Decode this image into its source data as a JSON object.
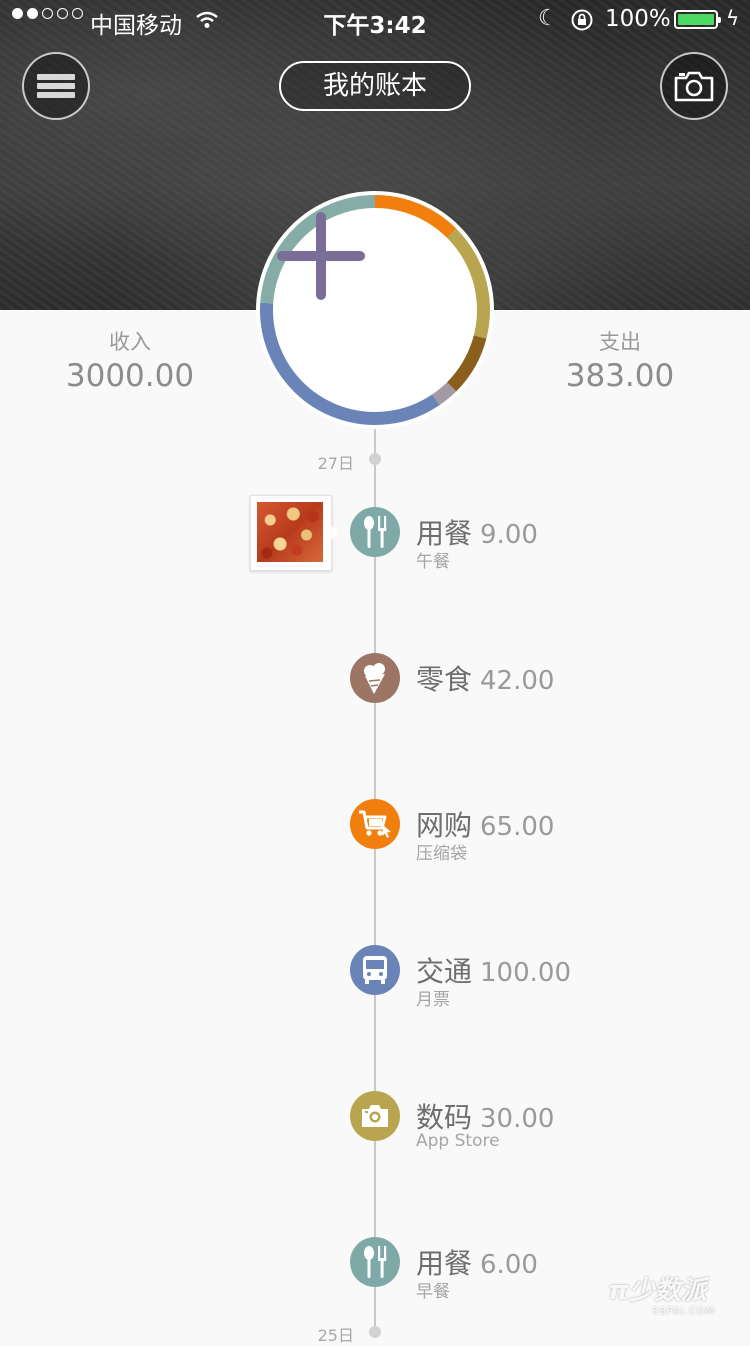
{
  "status_bar": {
    "carrier": "中国移动",
    "time": "下午3:42",
    "battery_percent": "100%",
    "signal_bars_filled": 2,
    "signal_bars_total": 5
  },
  "header": {
    "title": "我的账本",
    "menu_icon": "hamburger-menu-icon",
    "camera_icon": "camera-icon"
  },
  "summary": {
    "income_label": "收入",
    "income_value": "3000.00",
    "expense_label": "支出",
    "expense_value": "383.00"
  },
  "ring": {
    "colors": [
      "#f07f0e",
      "#b9a44f",
      "#8a5e1c",
      "#a49aa6",
      "#6b84b8",
      "#85aca6"
    ]
  },
  "add_button": {
    "icon": "plus-icon",
    "color": "#7a6e98"
  },
  "timeline": {
    "date_top": "27日",
    "date_bottom": "25日",
    "entries": [
      {
        "category": "用餐",
        "amount": "9.00",
        "note": "午餐",
        "color": "#7fa9a6",
        "icon": "utensils-icon"
      },
      {
        "category": "零食",
        "amount": "42.00",
        "note": "",
        "color": "#9c7564",
        "icon": "ice-cream-icon"
      },
      {
        "category": "网购",
        "amount": "65.00",
        "note": "压缩袋",
        "color": "#f07f0e",
        "icon": "shopping-cart-icon"
      },
      {
        "category": "交通",
        "amount": "100.00",
        "note": "月票",
        "color": "#6b84b8",
        "icon": "bus-icon"
      },
      {
        "category": "数码",
        "amount": "30.00",
        "note": "App Store",
        "color": "#b9a44f",
        "icon": "camera-icon"
      },
      {
        "category": "用餐",
        "amount": "6.00",
        "note": "早餐",
        "color": "#7fa9a6",
        "icon": "utensils-icon"
      }
    ]
  },
  "watermark": {
    "main": "π少数派",
    "sub": "SSPAI.COM"
  }
}
